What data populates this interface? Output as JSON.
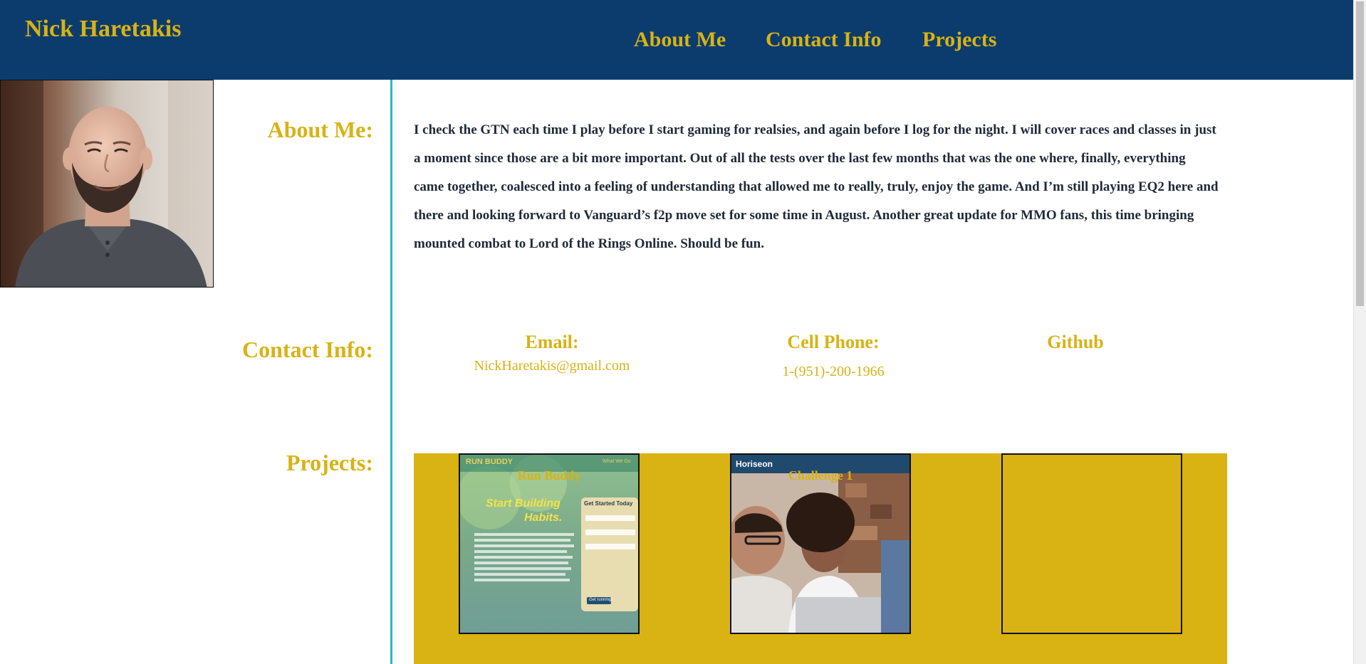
{
  "header": {
    "title": "Nick Haretakis",
    "nav": [
      {
        "label": "About Me"
      },
      {
        "label": "Contact Info"
      },
      {
        "label": "Projects"
      }
    ]
  },
  "about": {
    "label": "About Me:",
    "text": "I check the GTN each time I play before I start gaming for realsies, and again before I log for the night. I will cover races and classes in just a moment since those are a bit more important. Out of all the tests over the last few months that was the one where, finally, everything came together, coalesced into a feeling of understanding that allowed me to really, truly, enjoy the game. And I’m still playing EQ2 here and there and looking forward to Vanguard’s f2p move set for some time in August. Another great update for MMO fans, this time bringing mounted combat to Lord of the Rings Online. Should be fun."
  },
  "contact": {
    "label": "Contact Info:",
    "email_label": "Email:",
    "email_value": "NickHaretakis@gmail.com",
    "phone_label": "Cell Phone:",
    "phone_value": "1-(951)-200-1966",
    "github_label": "Github"
  },
  "projects": {
    "label": "Projects:",
    "items": [
      {
        "title": "Run Buddy",
        "brand": "RUN BUDDY",
        "nav_text": "What We Do",
        "headline_1": "Start Building",
        "headline_2": "Habits.",
        "form_title": "Get Started Today",
        "button": "Get running!"
      },
      {
        "title": "Challenge 1",
        "brand": "Horiseon"
      },
      {
        "title": ""
      }
    ]
  },
  "colors": {
    "header_bg": "#0b3c6d",
    "accent_gold": "#d9b214",
    "divider": "#2bb5c9",
    "body_text": "#1f2a3a"
  }
}
